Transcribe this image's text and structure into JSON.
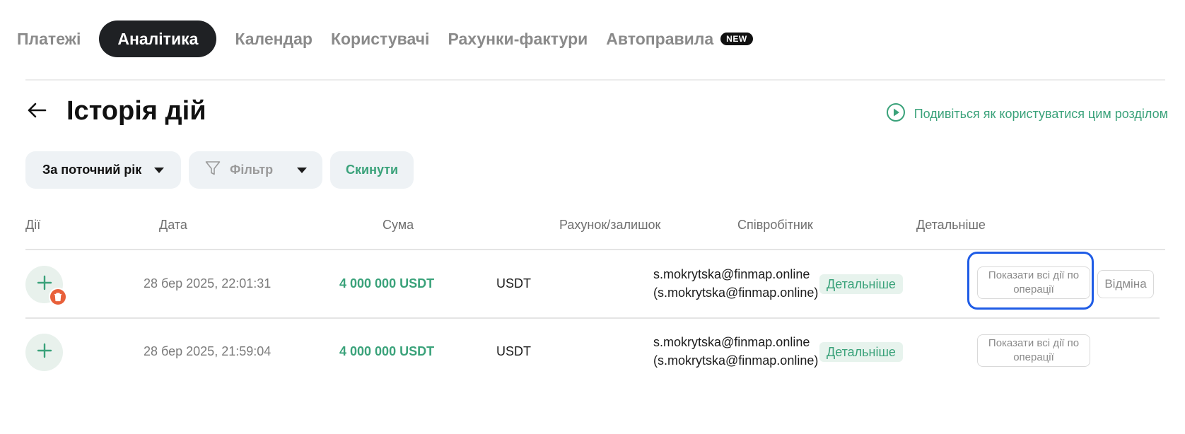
{
  "nav": {
    "tabs": [
      "Платежі",
      "Аналітика",
      "Календар",
      "Користувачі",
      "Рахунки-фактури",
      "Автоправила"
    ],
    "active_tab": "Аналітика",
    "new_badge": "NEW"
  },
  "header": {
    "title": "Історія дій",
    "howto_link": "Подивіться як користуватися цим розділом"
  },
  "filters": {
    "period": "За поточний рік",
    "filter": "Фільтр",
    "reset": "Скинути"
  },
  "table": {
    "columns": [
      "Дії",
      "Дата",
      "Сума",
      "Рахунок/залишок",
      "Співробітник",
      "Детальніше"
    ],
    "rows": [
      {
        "date": "28 бер 2025, 22:01:31",
        "amount": "4 000 000 USDT",
        "account": "USDT",
        "employee_line1": "s.mokrytska@finmap.online",
        "employee_line2": "(s.mokrytska@finmap.online)",
        "details": "Детальніше",
        "show_all_line1": "Показати всі дії по",
        "show_all_line2": "операції",
        "cancel": "Відміна"
      },
      {
        "date": "28 бер 2025, 21:59:04",
        "amount": "4 000 000 USDT",
        "account": "USDT",
        "employee_line1": "s.mokrytska@finmap.online",
        "employee_line2": "(s.mokrytska@finmap.online)",
        "details": "Детальніше",
        "show_all_line1": "Показати всі дії по",
        "show_all_line2": "операції"
      }
    ]
  },
  "icons": {
    "back": "arrow-left-icon",
    "howto": "play-circle-icon",
    "filter": "funnel-icon",
    "action": "plus-icon",
    "deleted": "trash-icon"
  },
  "colors": {
    "accent": "#3aa27a",
    "active_tab_bg": "#1f2124",
    "highlight": "#1f5ce6",
    "trash_badge": "#e8603a"
  }
}
